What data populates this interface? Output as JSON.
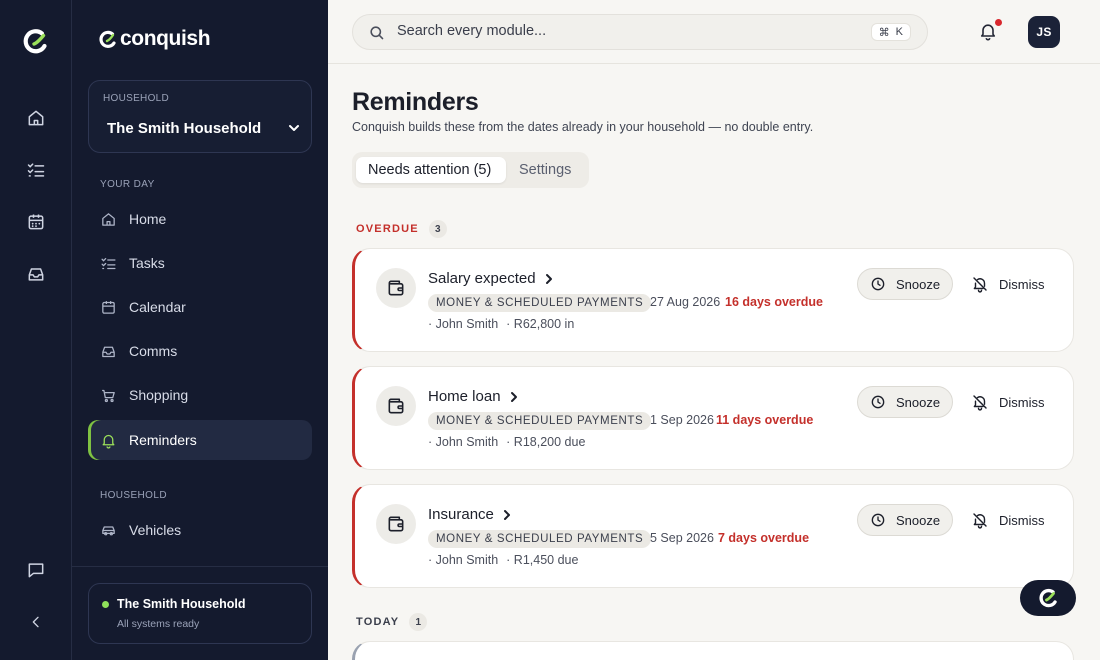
{
  "rail": {
    "icons": [
      "home-icon",
      "tasks-icon",
      "calendar-icon",
      "inbox-icon"
    ],
    "bottom_icons": [
      "chat-icon",
      "collapse-icon"
    ]
  },
  "sidebar": {
    "brand": "conquish",
    "household_caption": "HOUSEHOLD",
    "household_name": "The Smith Household",
    "your_day_label": "YOUR DAY",
    "your_day_items": [
      {
        "label": "Home",
        "icon": "home-icon"
      },
      {
        "label": "Tasks",
        "icon": "tasks-icon"
      },
      {
        "label": "Calendar",
        "icon": "calendar-icon"
      },
      {
        "label": "Comms",
        "icon": "inbox-icon"
      },
      {
        "label": "Shopping",
        "icon": "cart-icon"
      },
      {
        "label": "Reminders",
        "icon": "bell-icon",
        "active": true
      }
    ],
    "household_label": "HOUSEHOLD",
    "household_items": [
      {
        "label": "Vehicles",
        "icon": "car-icon"
      }
    ],
    "status": {
      "title": "The Smith Household",
      "subtitle": "All systems ready"
    }
  },
  "topbar": {
    "search_placeholder": "Search every module...",
    "shortcut_symbol": "⌘",
    "shortcut_key": "K",
    "avatar_initials": "JS"
  },
  "page": {
    "title": "Reminders",
    "subtitle": "Conquish builds these from the dates already in your household — no double entry.",
    "tabs": [
      {
        "label": "Needs attention (5)",
        "active": true
      },
      {
        "label": "Settings",
        "active": false
      }
    ]
  },
  "groups": {
    "overdue": {
      "label": "OVERDUE",
      "count": "3"
    },
    "today": {
      "label": "TODAY",
      "count": "1"
    }
  },
  "reminders": [
    {
      "title": "Salary expected",
      "tag": "MONEY & SCHEDULED PAYMENTS",
      "date": "27 Aug 2026",
      "overdue": "16 days overdue",
      "person": "· John Smith",
      "amount": "· R62,800 in"
    },
    {
      "title": "Home loan",
      "tag": "MONEY & SCHEDULED PAYMENTS",
      "date": "1 Sep 2026",
      "overdue": "11 days overdue",
      "person": "· John Smith",
      "amount": "· R18,200 due"
    },
    {
      "title": "Insurance",
      "tag": "MONEY & SCHEDULED PAYMENTS",
      "date": "5 Sep 2026",
      "overdue": "7 days overdue",
      "person": "· John Smith",
      "amount": "· R1,450 due"
    }
  ],
  "actions": {
    "snooze": "Snooze",
    "dismiss": "Dismiss"
  },
  "colors": {
    "sidebar_bg": "#141a2e",
    "accent_green": "#7fc242",
    "overdue_red": "#c4302b",
    "notification_dot": "#d8272d"
  }
}
